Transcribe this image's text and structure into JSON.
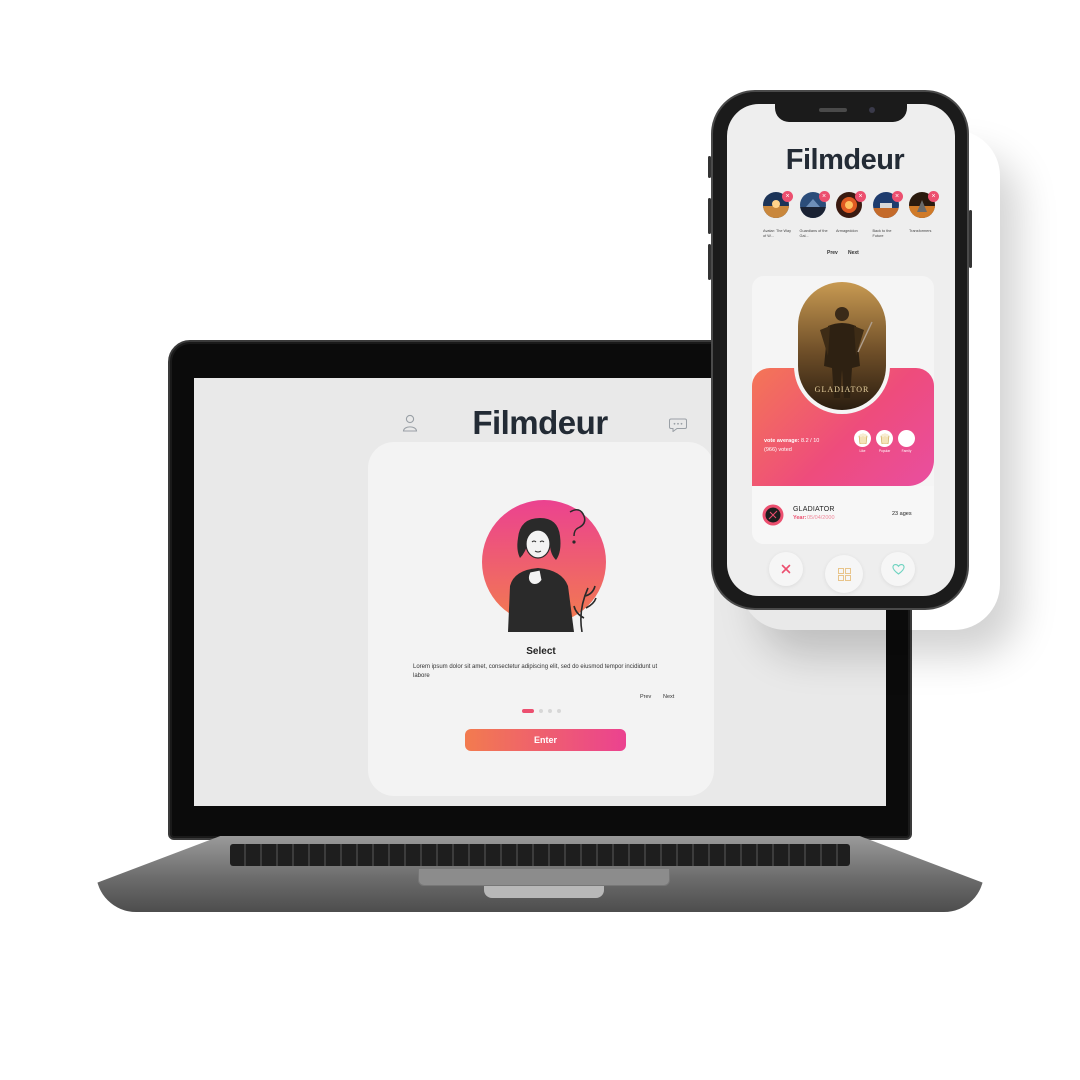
{
  "colors": {
    "accent": "#ec4f6f",
    "gradient_start": "#f27b4f",
    "gradient_end": "#eb4290",
    "logo": "#232b35",
    "screen_bg": "#e9e9e9",
    "card_bg": "#f3f3f3"
  },
  "laptop": {
    "logo": "Filmdeur",
    "icons": {
      "left": "profile-icon",
      "right": "chat-icon"
    },
    "onboarding": {
      "title": "Select",
      "description": "Lorem ipsum dolor sit amet, consectetur adipiscing elit, sed do eiusmod tempor incididunt ut labore",
      "prev_label": "Prev",
      "next_label": "Next",
      "dots_total": 4,
      "active_dot": 1,
      "enter_label": "Enter"
    }
  },
  "phone": {
    "logo": "Filmdeur",
    "selected_movies": [
      {
        "title": "Avatar: The Way of W...",
        "remove_icon": "close-icon"
      },
      {
        "title": "Guardians of the Gal...",
        "remove_icon": "close-icon"
      },
      {
        "title": "Armageddon",
        "remove_icon": "close-icon"
      },
      {
        "title": "Back to the Future",
        "remove_icon": "close-icon"
      },
      {
        "title": "Transformers",
        "remove_icon": "close-icon"
      }
    ],
    "prev_label": "Prev",
    "next_label": "Next",
    "movie_card": {
      "vote_label": "vote average:",
      "vote_value": "8.2 / 10",
      "voted_count": "(966) voted",
      "tags": [
        "Like",
        "Popular",
        "Family"
      ],
      "title": "GLADIATOR",
      "year_label": "Year:",
      "year_value": "05/04/2000",
      "ago": "23 ages"
    },
    "actions": [
      "close-icon",
      "grid-icon",
      "heart-icon"
    ]
  }
}
